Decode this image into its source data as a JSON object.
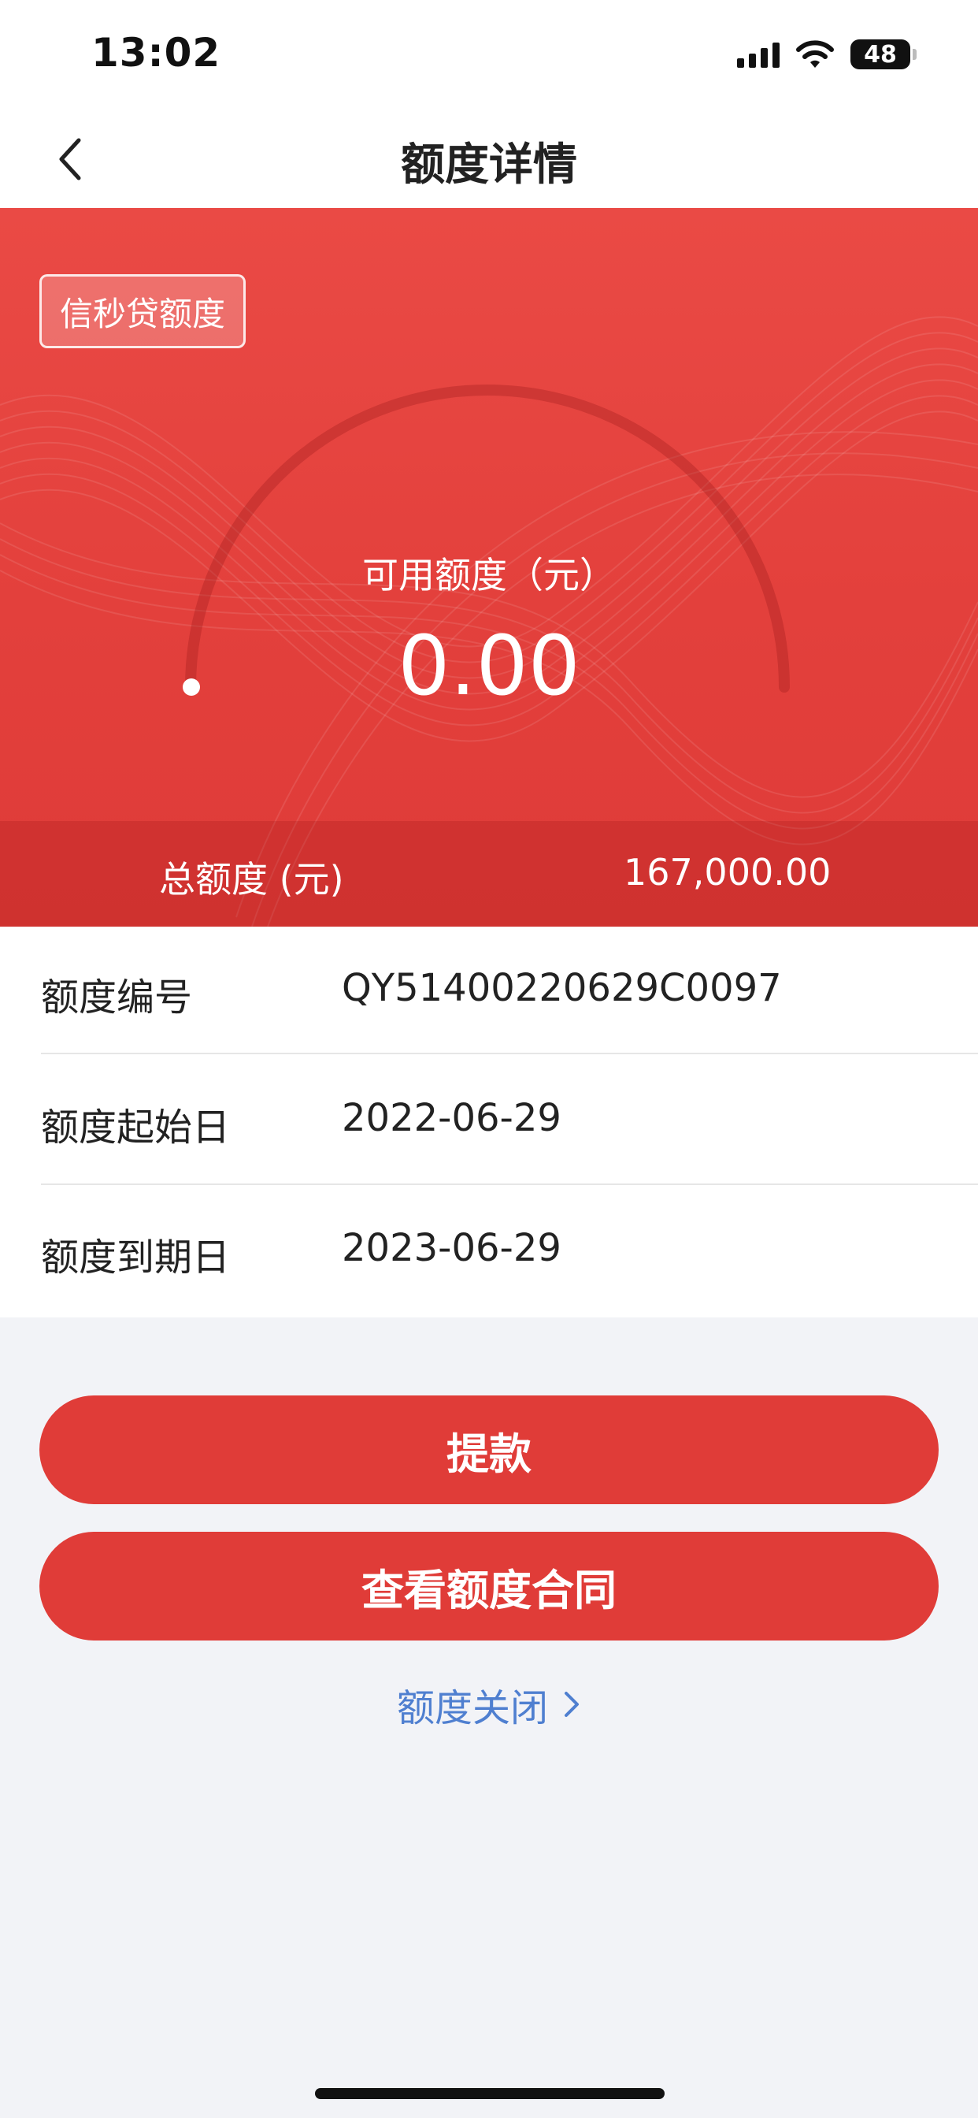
{
  "status_bar": {
    "time": "13:02",
    "battery": "48",
    "icons": [
      "signal-icon",
      "wifi-icon",
      "battery-icon"
    ]
  },
  "nav": {
    "title": "额度详情",
    "back_icon": "chevron-left-icon"
  },
  "hero": {
    "badge": "信秒贷额度",
    "available_label": "可用额度（元）",
    "available_value": "0.00",
    "total_label": "总额度 (元)",
    "total_value": "167,000.00"
  },
  "info_rows": [
    {
      "label": "额度编号",
      "value": "QY51400220629C0097"
    },
    {
      "label": "额度起始日",
      "value": "2022-06-29"
    },
    {
      "label": "额度到期日",
      "value": "2023-06-29"
    }
  ],
  "actions": {
    "withdraw": "提款",
    "view_contract": "查看额度合同",
    "close_limit": "额度关闭"
  },
  "colors": {
    "primary": "#e03c38",
    "link": "#4f7fd0",
    "background": "#f2f3f7"
  }
}
